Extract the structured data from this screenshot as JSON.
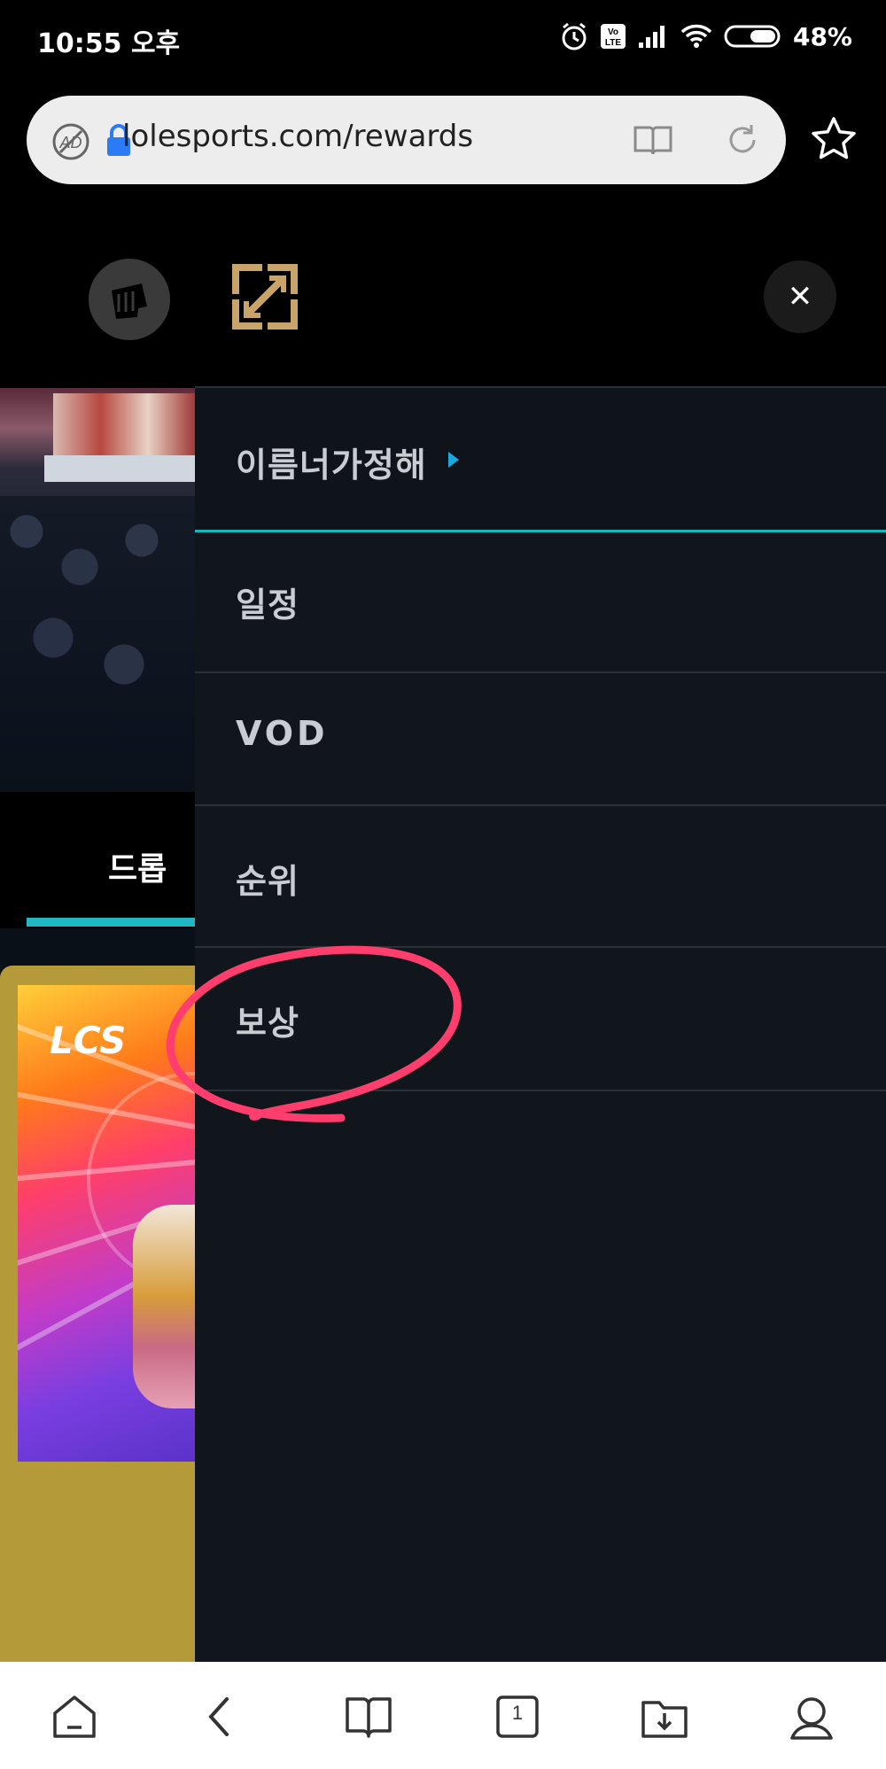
{
  "status_bar": {
    "time": "10:55 오후",
    "battery": "48%",
    "icons": [
      "alarm-icon",
      "volte-icon",
      "signal-icon",
      "wifi-icon",
      "battery-icon"
    ]
  },
  "browser": {
    "url": "lolesports.com/rewards",
    "icons": [
      "adblock-icon",
      "lock-icon",
      "reader-mode-icon",
      "reload-icon",
      "star-icon"
    ]
  },
  "header": {
    "close_glyph": "✕",
    "icons": [
      "riot-logo-icon",
      "expand-icon"
    ]
  },
  "background_page": {
    "tab_label": "드롭",
    "card_logo": "LCS"
  },
  "menu": {
    "profile_name": "이름너가정해",
    "items": [
      {
        "label": "일정"
      },
      {
        "label": "VOD"
      },
      {
        "label": "순위"
      },
      {
        "label": "보상"
      }
    ]
  },
  "bottom_nav": {
    "icons": [
      "home-icon",
      "back-icon",
      "bookmarks-icon",
      "tabs-icon",
      "downloads-icon",
      "profile-icon"
    ],
    "tab_count": "1"
  },
  "colors": {
    "accent_teal": "#16b6bf",
    "annotation": "#ff3e6e",
    "menu_bg": "#11161d"
  }
}
